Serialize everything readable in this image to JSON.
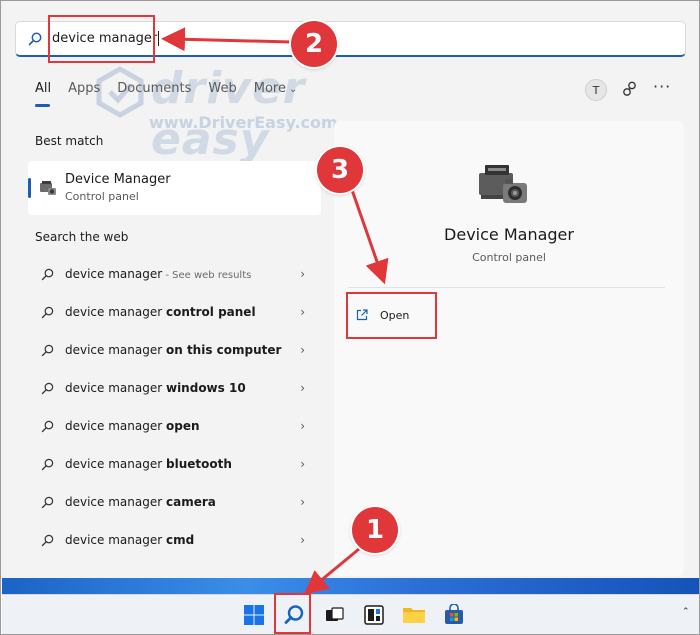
{
  "search": {
    "query": "device manager"
  },
  "tabs": [
    {
      "label": "All",
      "active": true
    },
    {
      "label": "Apps",
      "active": false
    },
    {
      "label": "Documents",
      "active": false
    },
    {
      "label": "Web",
      "active": false
    },
    {
      "label": "More",
      "active": false
    }
  ],
  "header": {
    "avatar_initial": "T",
    "more_label": "···"
  },
  "watermark": {
    "brand": "driver easy",
    "url": "www.DriverEasy.com"
  },
  "best_match": {
    "section_title": "Best match",
    "title": "Device Manager",
    "subtitle": "Control panel"
  },
  "web": {
    "section_title": "Search the web",
    "items": [
      {
        "prefix": "device manager",
        "bold": "",
        "hint": " - See web results"
      },
      {
        "prefix": "device manager ",
        "bold": "control panel",
        "hint": ""
      },
      {
        "prefix": "device manager ",
        "bold": "on this computer",
        "hint": ""
      },
      {
        "prefix": "device manager ",
        "bold": "windows 10",
        "hint": ""
      },
      {
        "prefix": "device manager ",
        "bold": "open",
        "hint": ""
      },
      {
        "prefix": "device manager ",
        "bold": "bluetooth",
        "hint": ""
      },
      {
        "prefix": "device manager ",
        "bold": "camera",
        "hint": ""
      },
      {
        "prefix": "device manager ",
        "bold": "cmd",
        "hint": ""
      }
    ]
  },
  "details": {
    "title": "Device Manager",
    "subtitle": "Control panel",
    "open_label": "Open"
  },
  "callouts": {
    "step1": "1",
    "step2": "2",
    "step3": "3"
  },
  "colors": {
    "accent": "#1a5fb4",
    "callout": "#e0373a",
    "panel": "#f3f3f3"
  }
}
